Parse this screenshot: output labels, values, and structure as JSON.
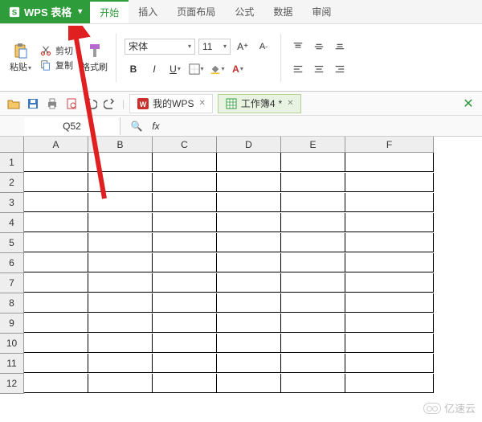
{
  "app": {
    "name": "WPS 表格"
  },
  "menu": {
    "items": [
      "开始",
      "插入",
      "页面布局",
      "公式",
      "数据",
      "审阅"
    ],
    "activeIndex": 0
  },
  "ribbon": {
    "paste": "粘贴",
    "cut": "剪切",
    "copy": "复制",
    "format_painter": "格式刷",
    "font_name": "宋体",
    "font_size": "11",
    "bold": "B",
    "italic": "I",
    "underline": "U"
  },
  "doctabs": {
    "wps_home": "我的WPS",
    "workbook": "工作簿4",
    "dirty": "*"
  },
  "namebox": {
    "ref": "Q52",
    "fx": "fx"
  },
  "sheet": {
    "cols": [
      "A",
      "B",
      "C",
      "D",
      "E",
      "F"
    ],
    "rows": [
      "1",
      "2",
      "3",
      "4",
      "5",
      "6",
      "7",
      "8",
      "9",
      "10",
      "11",
      "12"
    ]
  },
  "watermark": "亿速云"
}
